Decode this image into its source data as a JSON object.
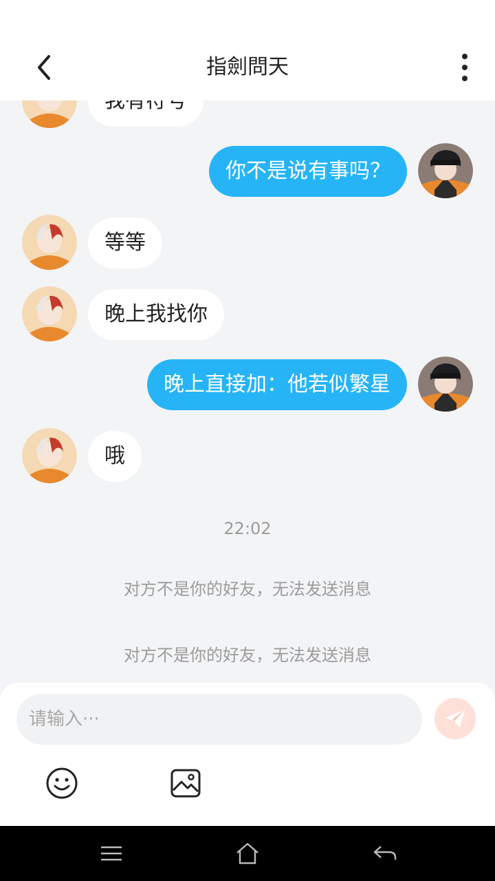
{
  "header": {
    "title": "指劍問天",
    "back_icon": "chevron-left-icon",
    "more_icon": "more-vertical-icon"
  },
  "messages": [
    {
      "side": "left",
      "text": "我有符号",
      "avatar": "contact-avatar"
    },
    {
      "side": "right",
      "text": "你不是说有事吗？",
      "avatar": "my-avatar"
    },
    {
      "side": "left",
      "text": "等等",
      "avatar": "contact-avatar"
    },
    {
      "side": "left",
      "text": "晚上我找你",
      "avatar": "contact-avatar"
    },
    {
      "side": "right",
      "text": "晚上直接加：他若似繁星",
      "avatar": "my-avatar"
    },
    {
      "side": "left",
      "text": "哦",
      "avatar": "contact-avatar"
    }
  ],
  "timestamp": "22:02",
  "notices": [
    "对方不是你的好友，无法发送消息",
    "对方不是你的好友，无法发送消息"
  ],
  "composer": {
    "placeholder": "请输入···",
    "value": "",
    "send_icon": "send-icon",
    "emoji_icon": "smile-icon",
    "image_icon": "image-icon"
  },
  "navbar": {
    "icons": [
      "menu-icon",
      "home-icon",
      "back-arrow-icon"
    ]
  },
  "colors": {
    "outgoing_bubble": "#26b4f7",
    "incoming_bubble": "#ffffff",
    "send_button": "#ffe0d8",
    "background": "#f3f4f6"
  }
}
